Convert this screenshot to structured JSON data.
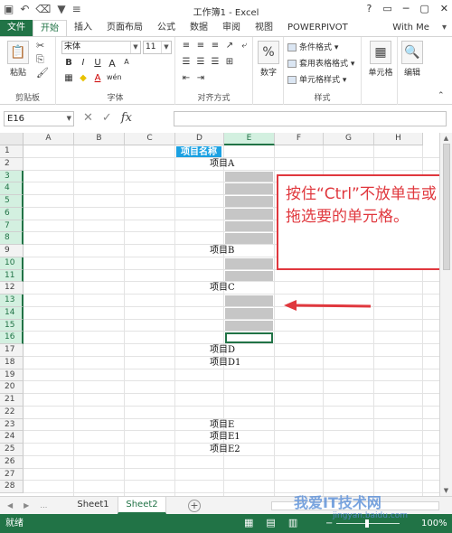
{
  "window": {
    "title": "工作簿1 - Excel",
    "controls": [
      "?",
      "▭",
      "─",
      "▢",
      "✕"
    ]
  },
  "qat": [
    "save-icon",
    "undo-icon",
    "eraser-icon",
    "filter-icon",
    "more-icon"
  ],
  "tabs": [
    {
      "label": "文件"
    },
    {
      "label": "开始"
    },
    {
      "label": "插入"
    },
    {
      "label": "页面布局"
    },
    {
      "label": "公式"
    },
    {
      "label": "数据"
    },
    {
      "label": "审阅"
    },
    {
      "label": "视图"
    },
    {
      "label": "POWERPIVOT"
    }
  ],
  "user": {
    "label": "With Me",
    "caret": "▾"
  },
  "ribbon": {
    "clipboard": {
      "paste": "粘贴",
      "label": "剪贴板"
    },
    "font": {
      "name": "宋体",
      "size": "11",
      "label": "字体",
      "bold": "B",
      "italic": "I",
      "underline": "U",
      "grow": "A",
      "shrink": "A",
      "fontcolor": "A",
      "wen": "wén"
    },
    "align": {
      "label": "对齐方式"
    },
    "number": {
      "button": "数字",
      "symbol": "%"
    },
    "styles": {
      "label": "样式",
      "items": [
        "条件格式 ▾",
        "套用表格格式 ▾",
        "单元格样式 ▾"
      ]
    },
    "cells": {
      "button": "单元格"
    },
    "edit": {
      "button": "编辑"
    }
  },
  "formula_bar": {
    "name_box": "E16",
    "fx": "fx",
    "cancel": "✕",
    "enter": "✓",
    "content": ""
  },
  "grid": {
    "columns": [
      "A",
      "B",
      "C",
      "D",
      "E",
      "F",
      "G",
      "H"
    ],
    "rows": [
      "1",
      "2",
      "3",
      "4",
      "5",
      "6",
      "7",
      "8",
      "9",
      "10",
      "11",
      "12",
      "13",
      "14",
      "15",
      "16",
      "17",
      "18",
      "19",
      "20",
      "21",
      "22",
      "23",
      "24",
      "25",
      "26",
      "27",
      "28"
    ],
    "cells": {
      "header": "项目名称",
      "items": [
        {
          "row": 2,
          "text": "项目A"
        },
        {
          "row": 9,
          "text": "项目B"
        },
        {
          "row": 12,
          "text": "项目C"
        },
        {
          "row": 17,
          "text": "项目D"
        },
        {
          "row": 18,
          "text": "项目D1"
        },
        {
          "row": 23,
          "text": "项目E"
        },
        {
          "row": 24,
          "text": "项目E1"
        },
        {
          "row": 25,
          "text": "项目E2"
        }
      ]
    },
    "selected_rows": [
      3,
      4,
      5,
      6,
      7,
      8,
      10,
      11,
      13,
      14,
      15,
      16
    ],
    "active_cell": "E16"
  },
  "callout": {
    "text": "按住“Ctrl”不放单击或拖选要的单元格。",
    "color": "#e0383e"
  },
  "sheets": {
    "tabs": [
      "Sheet1",
      "Sheet2"
    ],
    "active": "Sheet2",
    "add": "+"
  },
  "status": {
    "ready": "就绪",
    "zoom": "100%"
  },
  "watermark": {
    "text": "我爱IT技术网",
    "url": "jingyan.baidu.com"
  },
  "colors": {
    "excel_green": "#217346",
    "header_blue": "#1ba1e2",
    "selection_gray": "#c6c6c6"
  }
}
